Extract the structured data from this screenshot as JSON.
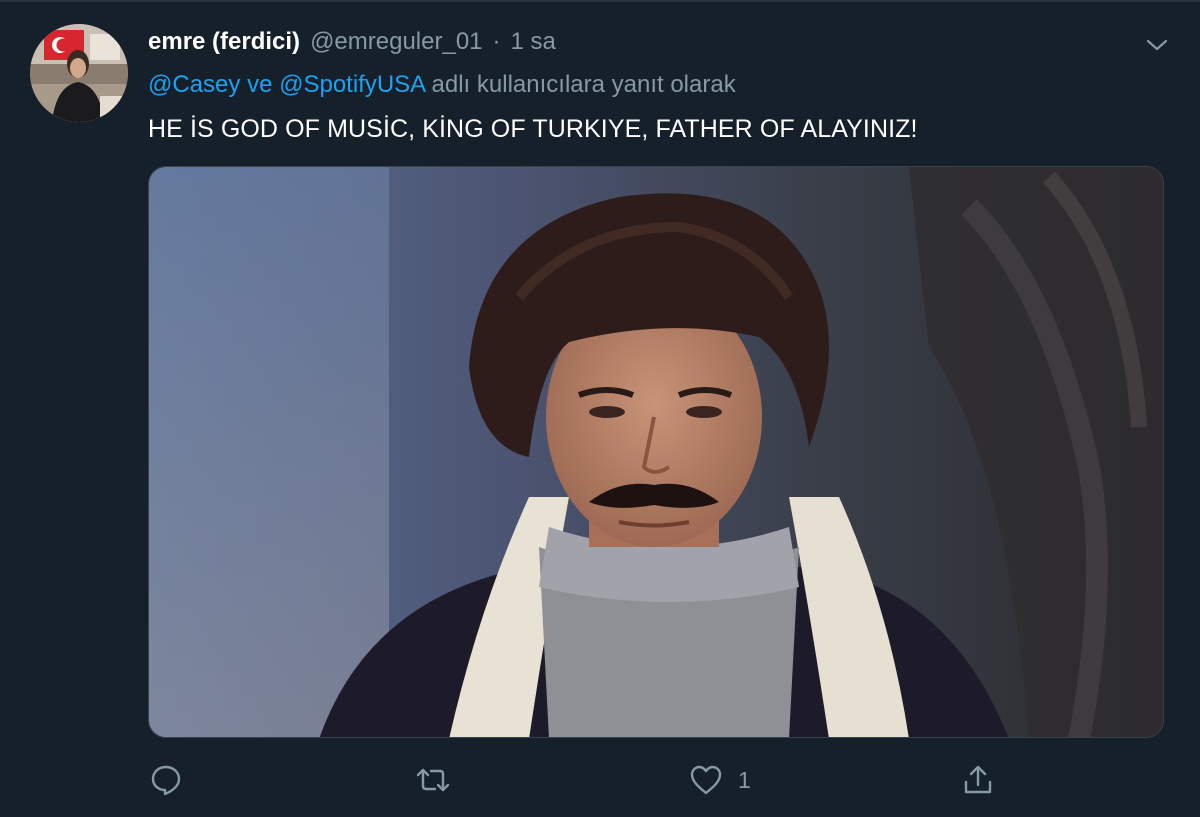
{
  "tweet": {
    "display_name": "emre (ferdici)",
    "handle": "@emreguler_01",
    "separator": "·",
    "time": "1 sa",
    "reply": {
      "mention1": "@Casey",
      "connector": "ve",
      "mention2": "@SpotifyUSA",
      "suffix": "adlı kullanıcılara yanıt olarak"
    },
    "text": "HE İS GOD OF MUSİC, KİNG OF TURKIYE, FATHER OF ALAYINIZ!",
    "actions": {
      "reply_icon": "comment-icon",
      "retweet_icon": "retweet-icon",
      "like_icon": "heart-icon",
      "like_count": "1",
      "share_icon": "share-icon"
    },
    "more_icon": "chevron-down-icon"
  },
  "colors": {
    "background": "#15202b",
    "primary_text": "#ffffff",
    "secondary_text": "#8899a6",
    "link": "#1da1f2"
  }
}
